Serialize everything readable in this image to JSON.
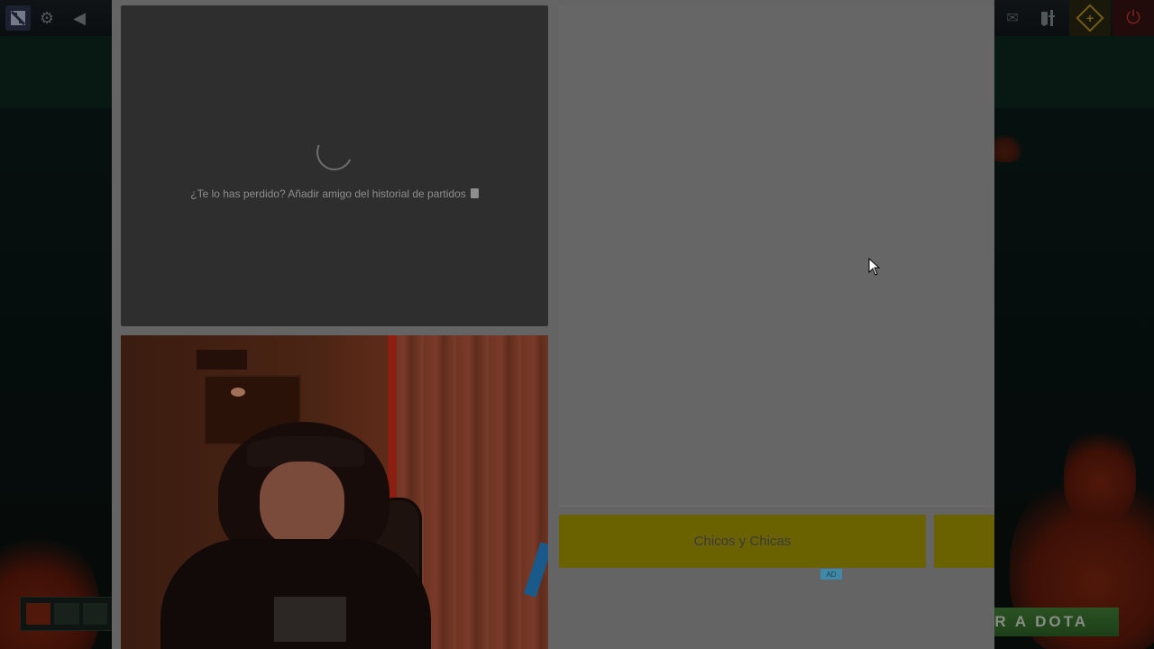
{
  "dota_client": {
    "icons": {
      "logo": "dota-logo-icon",
      "settings": "gear-icon",
      "back": "back-arrow-icon",
      "mail": "mail-icon",
      "armory": "armory-icon",
      "plus": "dota-plus-icon",
      "power": "power-icon"
    },
    "play_button_label": "AR A DOTA",
    "colors": {
      "plus_accent": "#c9a227",
      "power_accent": "#d63b2b",
      "play_green": "#4b8d3c"
    }
  },
  "overlay_page": {
    "match_history": {
      "loading_message": "¿Te lo has perdido? Añadir amigo del historial de partidos",
      "message_icon": "document-icon"
    },
    "ad": {
      "banner_text": "Chicos y Chicas",
      "badge": "AD",
      "banner_color": "#6a6100"
    }
  }
}
